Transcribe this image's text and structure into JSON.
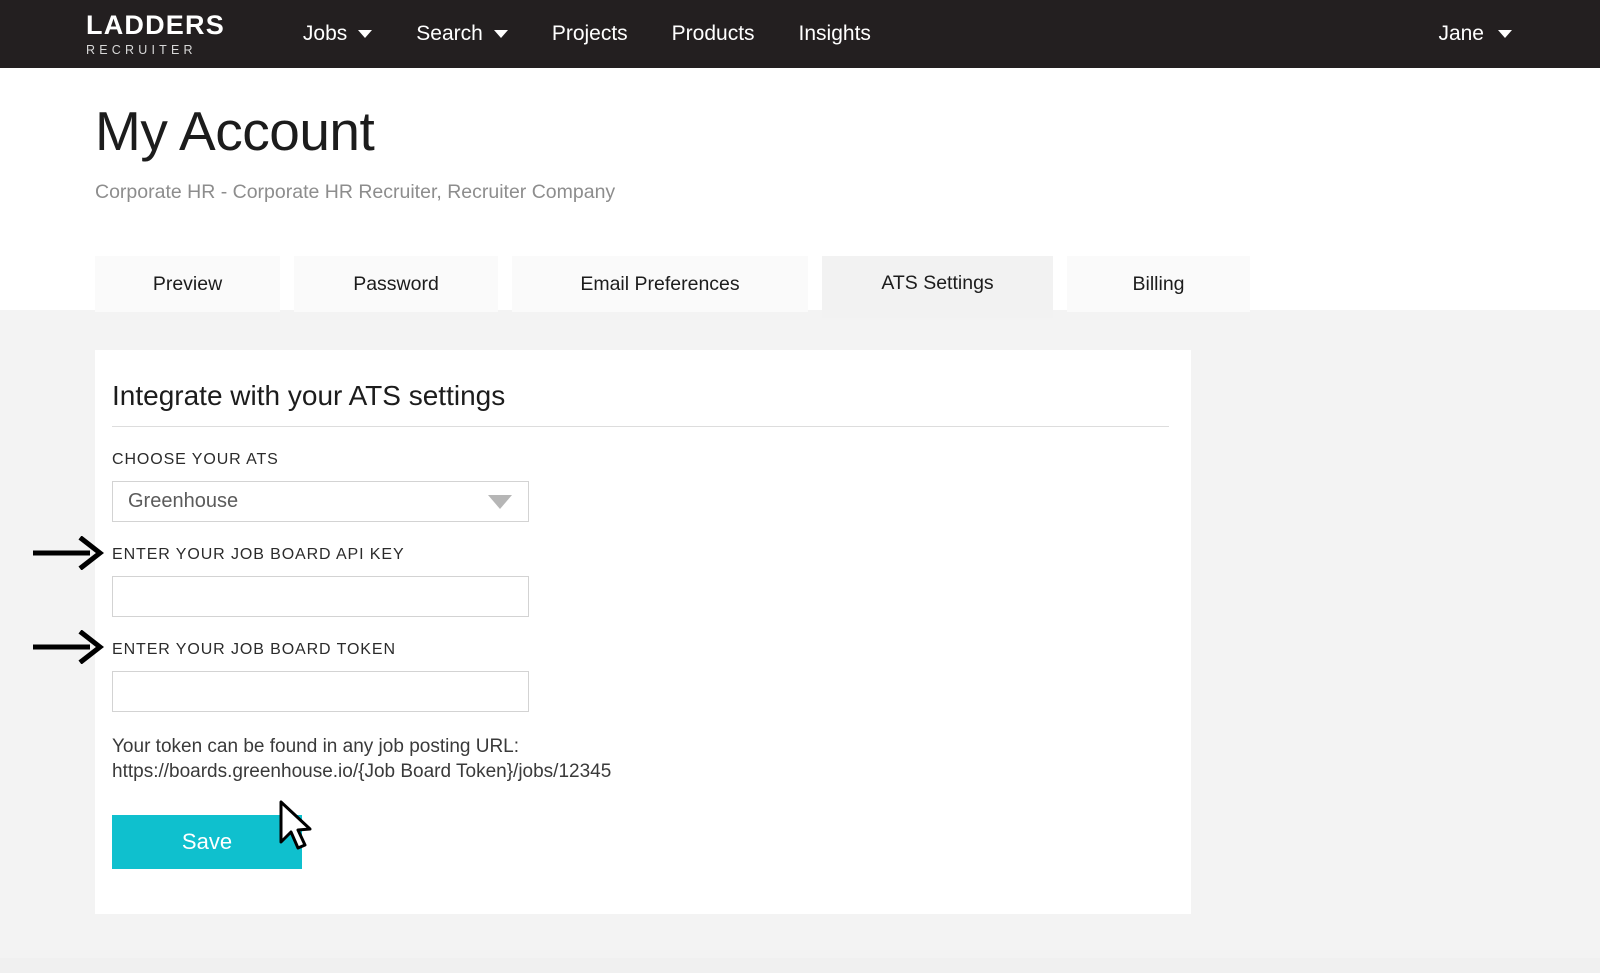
{
  "navbar": {
    "brand_main": "LADDERS",
    "brand_sub": "RECRUITER",
    "links": [
      {
        "label": "Jobs",
        "has_caret": true,
        "icon": "chevron-down-icon"
      },
      {
        "label": "Search",
        "has_caret": true,
        "icon": "chevron-down-icon"
      },
      {
        "label": "Projects",
        "has_caret": false
      },
      {
        "label": "Products",
        "has_caret": false
      },
      {
        "label": "Insights",
        "has_caret": false
      }
    ],
    "user_menu": {
      "label": "Jane",
      "icon": "chevron-down-icon"
    }
  },
  "header": {
    "title": "My Account",
    "subtitle": "Corporate HR - Corporate HR Recruiter, Recruiter Company"
  },
  "tabs": [
    {
      "label": "Preview",
      "active": false
    },
    {
      "label": "Password",
      "active": false
    },
    {
      "label": "Email Preferences",
      "active": false
    },
    {
      "label": "ATS Settings",
      "active": true
    },
    {
      "label": "Billing",
      "active": false
    }
  ],
  "card": {
    "title": "Integrate with your ATS settings",
    "ats_label": "CHOOSE YOUR ATS",
    "ats_selected": "Greenhouse",
    "api_key_label": "ENTER YOUR JOB BOARD API KEY",
    "api_key_value": "",
    "api_key_placeholder": "",
    "token_label": "ENTER YOUR JOB BOARD TOKEN",
    "token_value": "",
    "token_placeholder": "",
    "hint_line1": "Your token can be found in any job posting URL:",
    "hint_line2": "https://boards.greenhouse.io/{Job Board Token}/jobs/12345",
    "save_label": "Save"
  },
  "annotations": {
    "arrow_api_key": "arrow pointing to job board api key input",
    "arrow_token": "arrow pointing to job board token input"
  },
  "colors": {
    "navbar_bg": "#231f20",
    "accent": "#0fc0ce",
    "page_bg": "#f3f3f3",
    "card_bg": "#ffffff",
    "tab_bg": "#fafafa",
    "tab_active_bg": "#f2f2f2",
    "muted_text": "#8d8d8d"
  }
}
